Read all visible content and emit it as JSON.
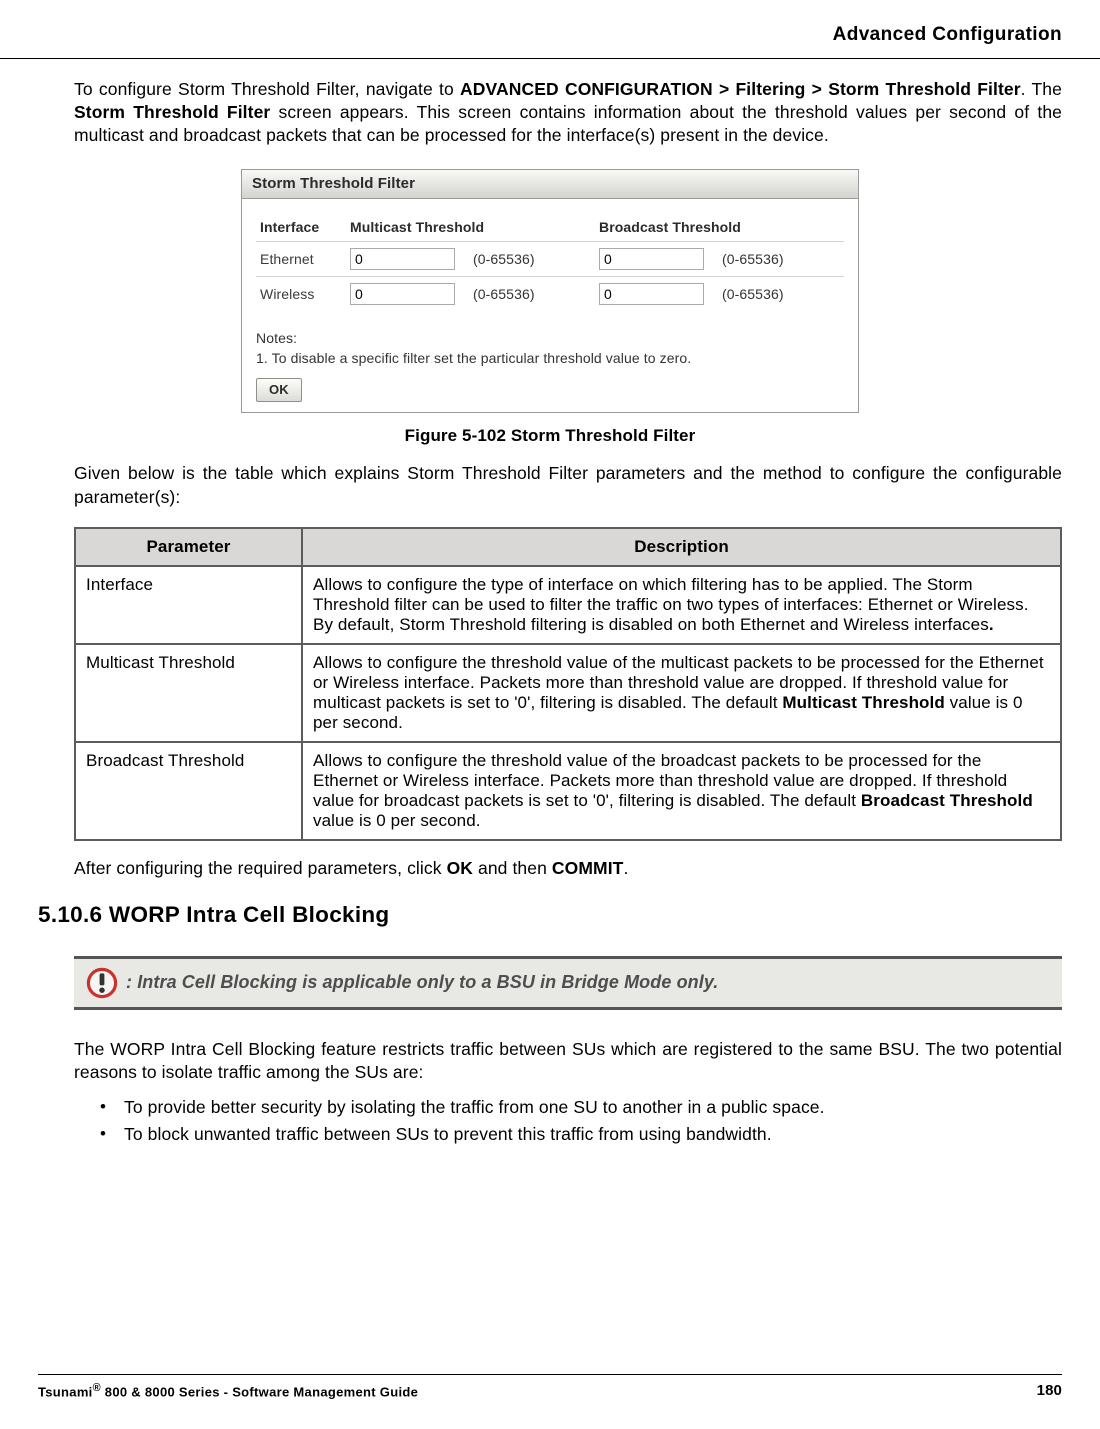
{
  "header": {
    "title": "Advanced Configuration"
  },
  "intro": {
    "pre": "To configure Storm Threshold Filter, navigate to ",
    "navpath": "ADVANCED CONFIGURATION > Filtering > Storm Threshold Filter",
    "mid": ". The ",
    "screenname": "Storm Threshold Filter",
    "post": " screen appears. This screen contains information about the threshold values per second of the multicast and broadcast packets that can be processed for the interface(s) present in the device."
  },
  "figure": {
    "title": "Storm Threshold Filter",
    "cols": {
      "iface": "Interface",
      "mcast": "Multicast Threshold",
      "bcast": "Broadcast Threshold"
    },
    "rows": [
      {
        "iface": "Ethernet",
        "mcast": "0",
        "mrange": "(0-65536)",
        "bcast": "0",
        "brange": "(0-65536)"
      },
      {
        "iface": "Wireless",
        "mcast": "0",
        "mrange": "(0-65536)",
        "bcast": "0",
        "brange": "(0-65536)"
      }
    ],
    "notes_hdr": "Notes:",
    "notes_line": "1. To disable a specific filter set the particular threshold value to zero.",
    "ok": "OK"
  },
  "figcap": "Figure 5-102 Storm Threshold Filter",
  "lead2": "Given below is the table which explains Storm Threshold Filter parameters and the method to configure the configurable parameter(s):",
  "ptable": {
    "h1": "Parameter",
    "h2": "Description",
    "rows": [
      {
        "p": "Interface",
        "d_pre": "Allows to configure the type of interface on which filtering has to be applied. The Storm Threshold filter can be used to filter the traffic on two types of interfaces: Ethernet or Wireless. By default, Storm Threshold filtering is disabled on both Ethernet and Wireless interfaces",
        "d_bold": ".",
        "d_post": ""
      },
      {
        "p": "Multicast Threshold",
        "d_pre": "Allows to configure the threshold value of the multicast packets to be processed for the Ethernet or Wireless interface. Packets more than threshold value are dropped. If threshold value for multicast packets is set to '0', filtering is disabled. The default ",
        "d_bold": "Multicast Threshold",
        "d_post": " value is 0 per second."
      },
      {
        "p": "Broadcast Threshold",
        "d_pre": "Allows to configure the threshold value of the broadcast packets to be processed for the Ethernet or Wireless interface. Packets more than threshold value are dropped. If threshold value for broadcast packets is set to '0', filtering is disabled. The default ",
        "d_bold": "Broadcast Threshold",
        "d_post": " value is 0 per second."
      }
    ]
  },
  "after": {
    "pre": "After configuring the required parameters, click ",
    "b1": "OK",
    "mid": " and then ",
    "b2": "COMMIT",
    "post": "."
  },
  "section_h2": "5.10.6 WORP Intra Cell Blocking",
  "note": ": Intra Cell Blocking is applicable only to a BSU in Bridge Mode only.",
  "worp_para": "The WORP Intra Cell Blocking feature restricts traffic between SUs which are registered to the same BSU. The two potential reasons to isolate traffic among the SUs are:",
  "bullets": [
    "To provide better security by isolating the traffic from one SU to another in a public space.",
    "To block unwanted traffic between SUs to prevent this traffic from using bandwidth."
  ],
  "footer": {
    "left_pre": "Tsunami",
    "reg": "®",
    "left_post": " 800 & 8000 Series - Software Management Guide",
    "page": "180"
  }
}
